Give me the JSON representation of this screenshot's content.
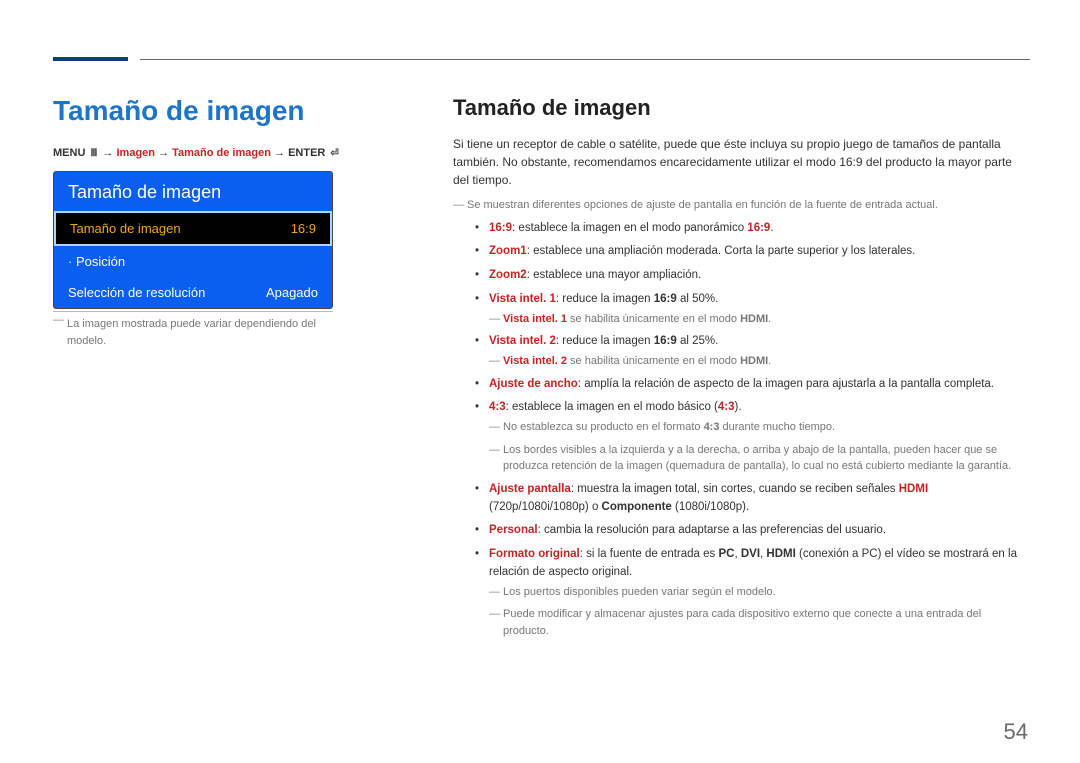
{
  "page_number": "54",
  "left": {
    "heading": "Tamaño de imagen",
    "breadcrumb": {
      "menu": "MENU",
      "sep": " → ",
      "a": "Imagen",
      "b": "Tamaño de imagen",
      "enter": "ENTER"
    },
    "menu": {
      "title": "Tamaño de imagen",
      "row_selected": {
        "label": "Tamaño de imagen",
        "value": "16:9"
      },
      "row_posicion": {
        "label": "Posición"
      },
      "row_resol": {
        "label": "Selección de resolución",
        "value": "Apagado"
      }
    },
    "note": "La imagen mostrada puede variar dependiendo del modelo."
  },
  "right": {
    "heading": "Tamaño de imagen",
    "intro": "Si tiene un receptor de cable o satélite, puede que éste incluya su propio juego de tamaños de pantalla también. No obstante, recomendamos encarecidamente utilizar el modo 16:9 del producto la mayor parte del tiempo.",
    "note_top": "Se muestran diferentes opciones de ajuste de pantalla en función de la fuente de entrada actual.",
    "items": {
      "i169_a": "16:9",
      "i169_b": ": establece la imagen en el modo panorámico ",
      "i169_c": "16:9",
      "i169_d": ".",
      "zoom1_a": "Zoom1",
      "zoom1_b": ": establece una ampliación moderada. Corta la parte superior y los laterales.",
      "zoom2_a": "Zoom2",
      "zoom2_b": ": establece una mayor ampliación.",
      "vi1_a": "Vista intel. 1",
      "vi1_b": ": reduce la imagen ",
      "vi1_c": "16:9",
      "vi1_d": " al 50%.",
      "vi1_note_a": "Vista intel. 1",
      "vi1_note_b": " se habilita únicamente en el modo ",
      "vi1_note_c": "HDMI",
      "vi1_note_d": ".",
      "vi2_a": "Vista intel. 2",
      "vi2_b": ": reduce la imagen ",
      "vi2_c": "16:9",
      "vi2_d": " al 25%.",
      "vi2_note_a": "Vista intel. 2",
      "vi2_note_b": " se habilita únicamente en el modo ",
      "vi2_note_c": "HDMI",
      "vi2_note_d": ".",
      "ancho_a": "Ajuste de ancho",
      "ancho_b": ": amplía la relación de aspecto de la imagen para ajustarla a la pantalla completa.",
      "r43_a": "4:3",
      "r43_b": ": establece la imagen en el modo básico (",
      "r43_c": "4:3",
      "r43_d": ").",
      "r43_note1_a": "No establezca su producto en el formato ",
      "r43_note1_b": "4:3",
      "r43_note1_c": " durante mucho tiempo.",
      "r43_note2": "Los bordes visibles a la izquierda y a la derecha, o arriba y abajo de la pantalla, pueden hacer que se produzca retención de la imagen (quemadura de pantalla), lo cual no está cubierto mediante la garantía.",
      "ap_a": "Ajuste pantalla",
      "ap_b": ": muestra la imagen total, sin cortes, cuando se reciben señales ",
      "ap_c": "HDMI",
      "ap_d": " (720p/1080i/1080p) o ",
      "ap_e": "Componente",
      "ap_f": " (1080i/1080p).",
      "pers_a": "Personal",
      "pers_b": ": cambia la resolución para adaptarse a las preferencias del usuario.",
      "fo_a": "Formato original",
      "fo_b": ": si la fuente de entrada es ",
      "fo_c": "PC",
      "fo_d": ", ",
      "fo_e": "DVI",
      "fo_f": ", ",
      "fo_g": "HDMI",
      "fo_h": " (conexión a PC) el vídeo se mostrará en la relación de aspecto original.",
      "end_note1": "Los puertos disponibles pueden variar según el modelo.",
      "end_note2": "Puede modificar y almacenar ajustes para cada dispositivo externo que conecte a una entrada del producto."
    }
  }
}
